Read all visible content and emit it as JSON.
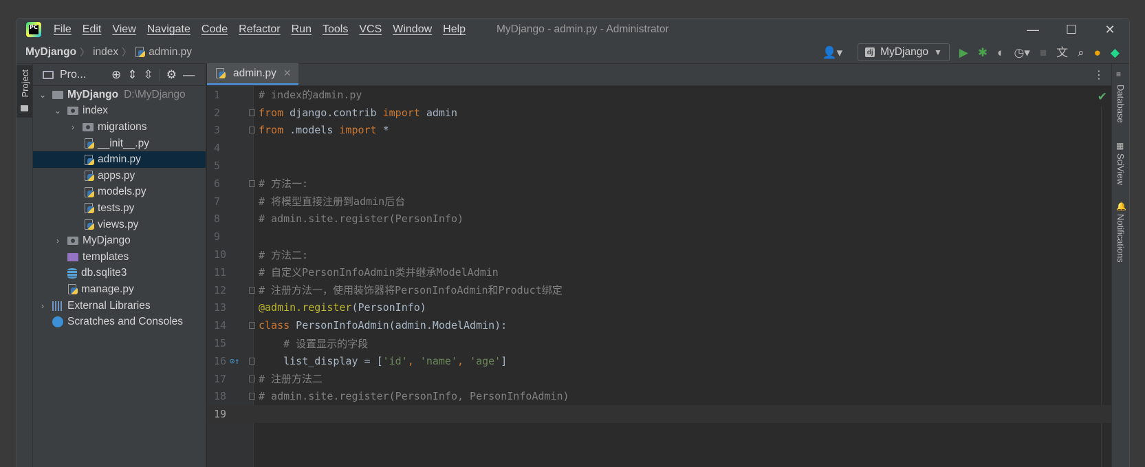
{
  "window": {
    "title": "MyDjango - admin.py - Administrator",
    "app_logo_text": "PC",
    "controls": {
      "minimize": "—",
      "maximize": "☐",
      "close": "✕"
    }
  },
  "menu": [
    "File",
    "Edit",
    "View",
    "Navigate",
    "Code",
    "Refactor",
    "Run",
    "Tools",
    "VCS",
    "Window",
    "Help"
  ],
  "breadcrumb": {
    "project": "MyDjango",
    "folder": "index",
    "file": "admin.py"
  },
  "toolbar": {
    "run_config": "MyDjango",
    "run_config_icon": "dj"
  },
  "left_stripe": {
    "project_label": "Project"
  },
  "project_panel": {
    "title": "Pro...",
    "tree": [
      {
        "label": "MyDjango",
        "path": "D:\\MyDjango"
      },
      {
        "label": "index"
      },
      {
        "label": "migrations"
      },
      {
        "label": "__init__.py"
      },
      {
        "label": "admin.py"
      },
      {
        "label": "apps.py"
      },
      {
        "label": "models.py"
      },
      {
        "label": "tests.py"
      },
      {
        "label": "views.py"
      },
      {
        "label": "MyDjango"
      },
      {
        "label": "templates"
      },
      {
        "label": "db.sqlite3"
      },
      {
        "label": "manage.py"
      },
      {
        "label": "External Libraries"
      },
      {
        "label": "Scratches and Consoles"
      }
    ]
  },
  "editor": {
    "tab_label": "admin.py",
    "line_numbers": [
      "1",
      "2",
      "3",
      "4",
      "5",
      "6",
      "7",
      "8",
      "9",
      "10",
      "11",
      "12",
      "13",
      "14",
      "15",
      "16",
      "17",
      "18",
      "19"
    ],
    "lines": {
      "l1": "# index的admin.py",
      "l2a": "from",
      "l2b": " django.contrib ",
      "l2c": "import",
      "l2d": " admin",
      "l3a": "from",
      "l3b": " .models ",
      "l3c": "import",
      "l3d": " *",
      "l6": "# 方法一:",
      "l7": "# 将模型直接注册到admin后台",
      "l8": "# admin.site.register(PersonInfo)",
      "l10": "# 方法二:",
      "l11": "# 自定义PersonInfoAdmin类并继承ModelAdmin",
      "l12": "# 注册方法一，使用装饰器将PersonInfoAdmin和Product绑定",
      "l13a": "@admin.register",
      "l13b": "(PersonInfo)",
      "l14a": "class",
      "l14b": " PersonInfoAdmin(admin.ModelAdmin):",
      "l15": "    # 设置显示的字段",
      "l16a": "    list_display = [",
      "l16b": "'id'",
      "l16c": ", ",
      "l16d": "'name'",
      "l16e": ", ",
      "l16f": "'age'",
      "l16g": "]",
      "l17": "# 注册方法二",
      "l18": "# admin.site.register(PersonInfo, PersonInfoAdmin)"
    }
  },
  "right_stripe": {
    "database": "Database",
    "sciview": "SciView",
    "notifications": "Notifications"
  }
}
